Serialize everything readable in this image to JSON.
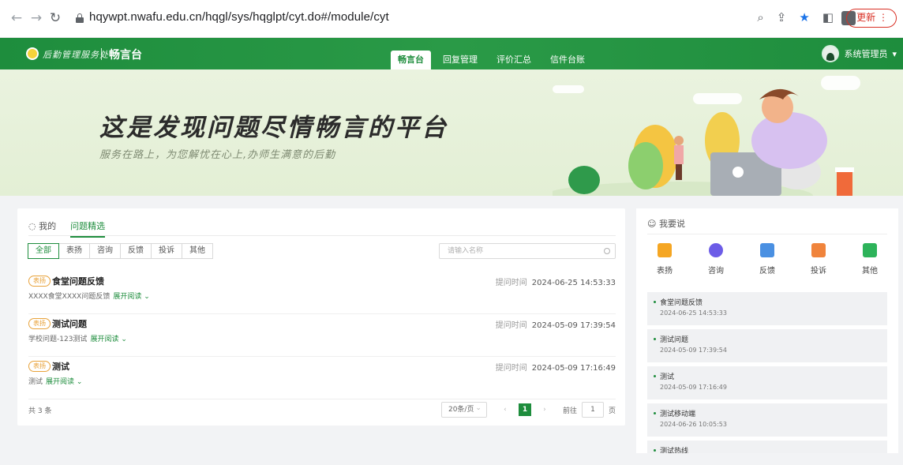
{
  "browser": {
    "url": "hqywpt.nwafu.edu.cn/hqgl/sys/hqglpt/cyt.do#/module/cyt",
    "update_label": "更新"
  },
  "header": {
    "logo_text": "后勤管理服务处",
    "app_name": "畅言台",
    "nav": [
      {
        "label": "畅言台",
        "active": true
      },
      {
        "label": "回复管理"
      },
      {
        "label": "评价汇总"
      },
      {
        "label": "信件台账"
      }
    ],
    "user_name": "系统管理员"
  },
  "banner": {
    "title": "这是发现问题尽情畅言的平台",
    "subtitle": "服务在路上，为您解忧在心上,办师生满意的后勤"
  },
  "main": {
    "tabs": [
      {
        "label": "我的"
      },
      {
        "label": "问题精选",
        "active": true
      }
    ],
    "filters": [
      {
        "label": "全部",
        "active": true
      },
      {
        "label": "表扬"
      },
      {
        "label": "咨询"
      },
      {
        "label": "反馈"
      },
      {
        "label": "投诉"
      },
      {
        "label": "其他"
      }
    ],
    "search_placeholder": "请输入名称",
    "time_label": "提问时间",
    "expand_label": "展开阅读",
    "items": [
      {
        "tag": "表扬",
        "title": "食堂问题反馈",
        "time": "2024-06-25 14:53:33",
        "desc": "XXXX食堂XXXX问题反馈"
      },
      {
        "tag": "表扬",
        "title": "测试问题",
        "time": "2024-05-09 17:39:54",
        "desc": "学校问题-123测试"
      },
      {
        "tag": "表扬",
        "title": "测试",
        "time": "2024-05-09 17:16:49",
        "desc": "测试"
      }
    ],
    "total": "共 3 条",
    "page_size": "20条/页",
    "current_page": "1",
    "goto_label": "前往",
    "goto_value": "1",
    "page_unit": "页"
  },
  "side": {
    "title": "我要说",
    "actions": [
      {
        "label": "表扬",
        "icon": "thumbs-up-icon",
        "color": "#f5a623"
      },
      {
        "label": "咨询",
        "icon": "question-icon",
        "color": "#6c5ce7"
      },
      {
        "label": "反馈",
        "icon": "feedback-icon",
        "color": "#4a90e2"
      },
      {
        "label": "投诉",
        "icon": "complaint-icon",
        "color": "#f0843c"
      },
      {
        "label": "其他",
        "icon": "grid-icon",
        "color": "#2db35a"
      }
    ],
    "recent": [
      {
        "title": "食堂问题反馈",
        "date": "2024-06-25 14:53:33"
      },
      {
        "title": "测试问题",
        "date": "2024-05-09 17:39:54"
      },
      {
        "title": "测试",
        "date": "2024-05-09 17:16:49"
      },
      {
        "title": "测试移动端",
        "date": "2024-06-26 10:05:53"
      },
      {
        "title": "测试热线",
        "date": ""
      }
    ]
  }
}
